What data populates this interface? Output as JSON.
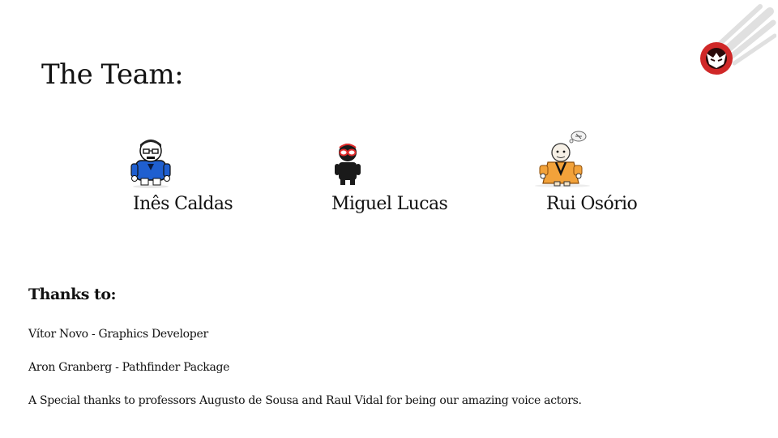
{
  "slide": {
    "title": "The Team:",
    "logo_icon": "meteor-demon-logo-icon"
  },
  "team": [
    {
      "name": "Inês Caldas",
      "avatar_icon": "blue-shirt-character-icon",
      "color": "#1f5fd0"
    },
    {
      "name": "Miguel Lucas",
      "avatar_icon": "black-hoodie-character-icon",
      "color": "#e02a2a"
    },
    {
      "name": "Rui Osório",
      "avatar_icon": "orange-robe-character-icon",
      "color": "#f2a23a"
    }
  ],
  "thanks": {
    "heading": "Thanks to:",
    "lines": [
      "Vítor Novo - Graphics Developer",
      "Aron Granberg - Pathfinder Package",
      "A Special thanks to professors Augusto de Sousa and  Raul Vidal for being our amazing voice actors."
    ]
  }
}
